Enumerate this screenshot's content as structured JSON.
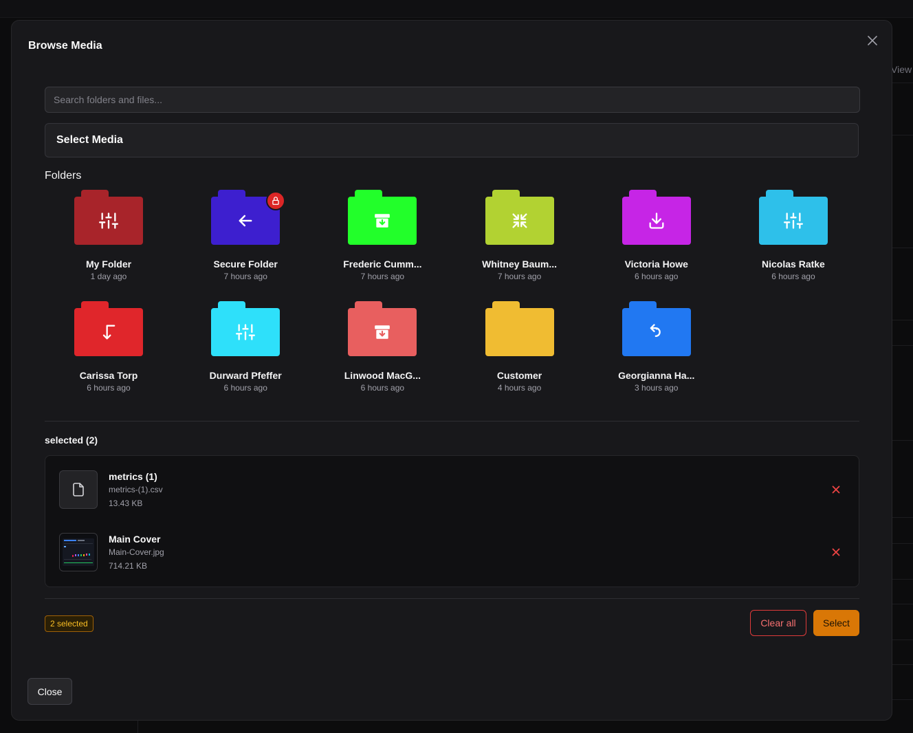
{
  "background": {
    "view_label": "View"
  },
  "modal": {
    "title": "Browse Media",
    "search_placeholder": "Search folders and files...",
    "select_media_label": "Select Media",
    "folders_heading": "Folders",
    "folders": [
      {
        "name": "My Folder",
        "time": "1 day ago",
        "color": "#a8242a",
        "icon": "sliders-icon",
        "locked": false
      },
      {
        "name": "Secure Folder",
        "time": "7 hours ago",
        "color": "#3d1fcf",
        "icon": "arrow-left-icon",
        "locked": true
      },
      {
        "name": "Frederic Cumm...",
        "time": "7 hours ago",
        "color": "#22ff2a",
        "icon": "archive-icon",
        "locked": false
      },
      {
        "name": "Whitney Baum...",
        "time": "7 hours ago",
        "color": "#b2d232",
        "icon": "shrink-icon",
        "locked": false
      },
      {
        "name": "Victoria Howe",
        "time": "6 hours ago",
        "color": "#c625e6",
        "icon": "download-icon",
        "locked": false
      },
      {
        "name": "Nicolas Ratke",
        "time": "6 hours ago",
        "color": "#2ec0ea",
        "icon": "sliders-icon",
        "locked": false
      },
      {
        "name": "Carissa Torp",
        "time": "6 hours ago",
        "color": "#e0262b",
        "icon": "corner-down-left-icon",
        "locked": false
      },
      {
        "name": "Durward Pfeffer",
        "time": "6 hours ago",
        "color": "#2ee0fa",
        "icon": "sliders-icon",
        "locked": false
      },
      {
        "name": "Linwood MacG...",
        "time": "6 hours ago",
        "color": "#e85f5f",
        "icon": "archive-icon",
        "locked": false
      },
      {
        "name": "Customer",
        "time": "4 hours ago",
        "color": "#f0bc32",
        "icon": "",
        "locked": false
      },
      {
        "name": "Georgianna Ha...",
        "time": "3 hours ago",
        "color": "#2178f2",
        "icon": "corner-up-icon",
        "locked": false
      }
    ],
    "selected_heading": "selected (2)",
    "selected_items": [
      {
        "title": "metrics (1)",
        "file": "metrics-(1).csv",
        "size": "13.43 KB",
        "thumb": "file-icon"
      },
      {
        "title": "Main Cover",
        "file": "Main-Cover.jpg",
        "size": "714.21 KB",
        "thumb": "image-thumbnail"
      }
    ],
    "count_badge": "2 selected",
    "clear_all_label": "Clear all",
    "select_label": "Select",
    "close_label": "Close"
  },
  "colors": {
    "accent": "#d97706",
    "danger": "#ef4444",
    "badge_text": "#fbbf24",
    "lock_badge": "#dc2626"
  }
}
